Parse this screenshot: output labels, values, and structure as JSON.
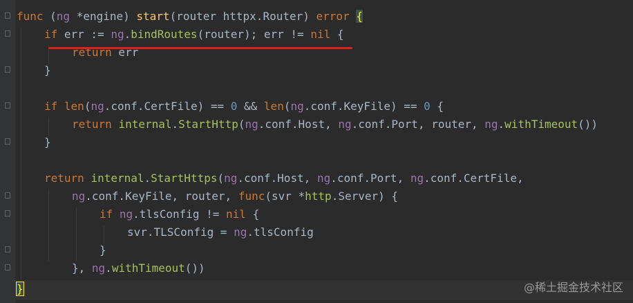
{
  "code": {
    "l1": {
      "func": "func",
      "open": " (",
      "rcv": "ng",
      "star": " *",
      "rtype": "engine",
      "close": ") ",
      "name": "start",
      "p1": "(router ",
      "pkg": "httpx",
      "dot": ".",
      "ptype": "Router",
      "p2": ") ",
      "ret": "error",
      "sp": " ",
      "brace": "{"
    },
    "l2": {
      "if": "if",
      "a": " err := ",
      "ng": "ng",
      "dot": ".",
      "call": "bindRoutes",
      "b": "(router); err != ",
      "nil": "nil",
      "c": " {"
    },
    "l3": {
      "ret": "return",
      "a": " err"
    },
    "l4": {
      "a": "}"
    },
    "l5": {
      "if": "if",
      "sp": " ",
      "len1": "len",
      "a": "(",
      "ng1": "ng",
      "b": ".conf.CertFile) == ",
      "z1": "0",
      "c": " && ",
      "len2": "len",
      "d": "(",
      "ng2": "ng",
      "e": ".conf.KeyFile) == ",
      "z2": "0",
      "f": " {"
    },
    "l6": {
      "ret": "return",
      "sp": " ",
      "pkg": "internal",
      "dot": ".",
      "fn": "StartHttp",
      "a": "(",
      "ng1": "ng",
      "b": ".conf.Host, ",
      "ng2": "ng",
      "c": ".conf.Port, router, ",
      "ng3": "ng",
      "d": ".",
      "fn2": "withTimeout",
      "e": "())"
    },
    "l7": {
      "a": "}"
    },
    "l8": {
      "ret": "return",
      "sp": " ",
      "pkg": "internal",
      "dot": ".",
      "fn": "StartHttps",
      "a": "(",
      "ng1": "ng",
      "b": ".conf.Host, ",
      "ng2": "ng",
      "c": ".conf.Port, ",
      "ng3": "ng",
      "d": ".conf.CertFile,"
    },
    "l9": {
      "ng": "ng",
      "a": ".conf.KeyFile, router, ",
      "func": "func",
      "b": "(svr *",
      "pkg": "http",
      "dot": ".",
      "ty": "Server",
      "c": ") {"
    },
    "l10": {
      "if": "if",
      "sp": " ",
      "ng": "ng",
      "a": ".tlsConfig != ",
      "nil": "nil",
      "b": " {"
    },
    "l11": {
      "a": "svr.TLSConfig = ",
      "ng": "ng",
      "b": ".tlsConfig"
    },
    "l12": {
      "a": "}"
    },
    "l13": {
      "a": "}, ",
      "ng": "ng",
      "dot": ".",
      "fn": "withTimeout",
      "b": "())"
    },
    "l14": {
      "brace": "}"
    }
  },
  "watermark": "@稀土掘金技术社区",
  "colors": {
    "background": "#2b2b2b",
    "keyword": "#cc7832",
    "function": "#ffc66d",
    "number": "#6897bb",
    "receiver": "#9876aa",
    "annotation": "#e0211b"
  }
}
